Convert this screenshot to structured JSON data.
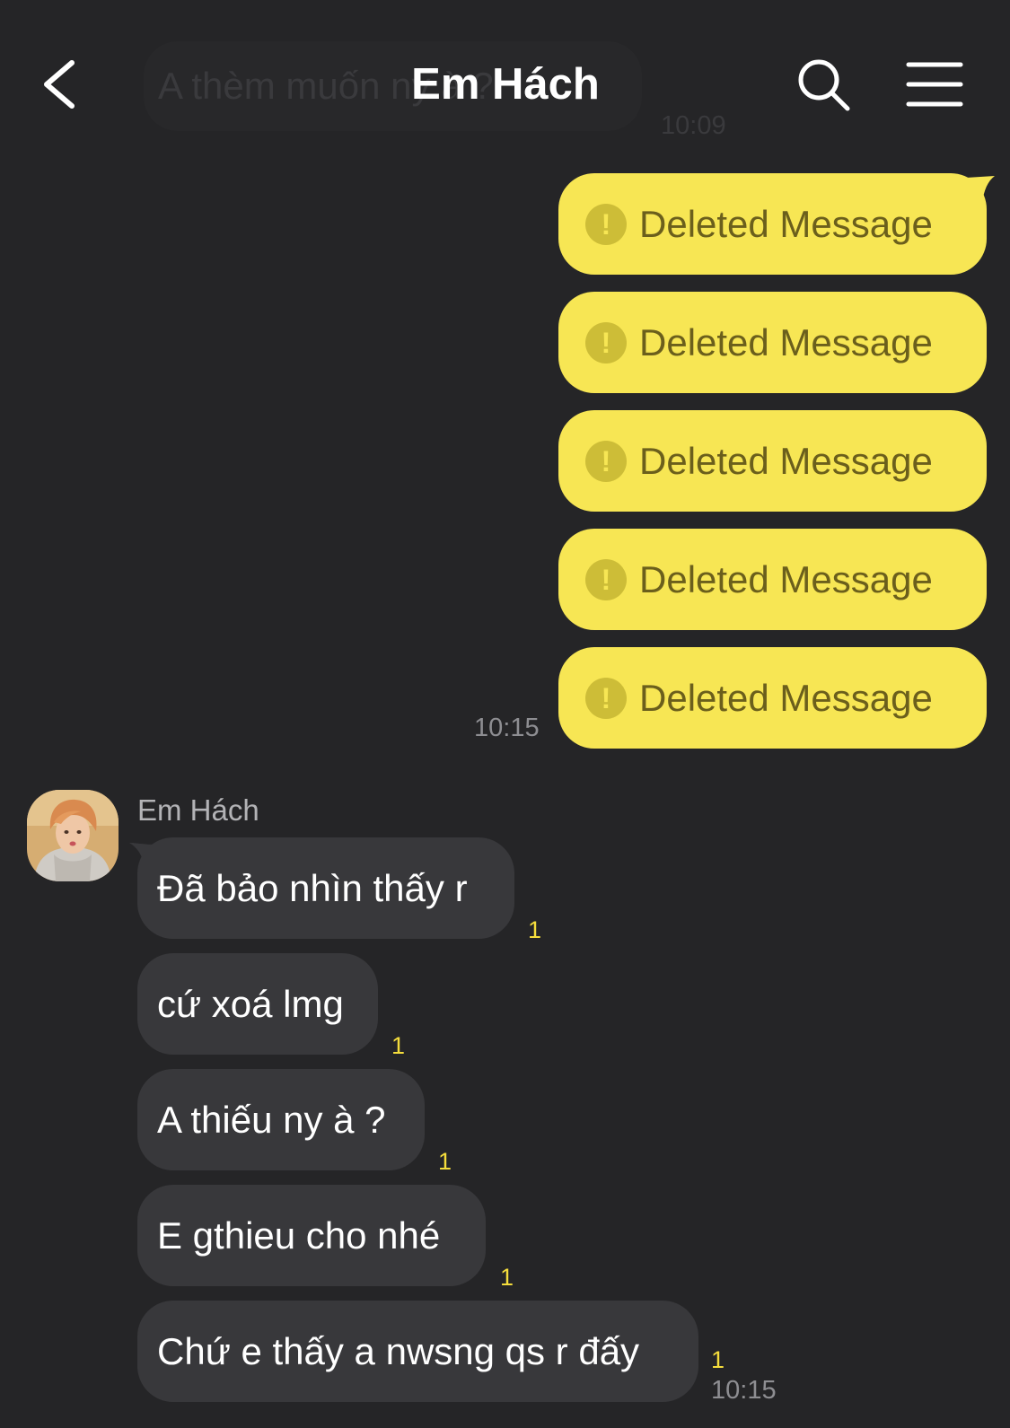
{
  "header": {
    "title": "Em Hách",
    "back_icon": "chevron-left-icon",
    "search_icon": "search-icon",
    "menu_icon": "hamburger-menu-icon"
  },
  "ghost": {
    "message": "A thèm muốn ny à ?",
    "time": "10:09"
  },
  "outgoing": {
    "deleted_label": "Deleted Message",
    "messages": [
      "Deleted Message",
      "Deleted Message",
      "Deleted Message",
      "Deleted Message",
      "Deleted Message"
    ],
    "time": "10:15"
  },
  "incoming": {
    "sender": "Em Hách",
    "messages": [
      {
        "text": "Đã bảo nhìn thấy r",
        "unread": "1"
      },
      {
        "text": "cứ xoá lmg",
        "unread": "1"
      },
      {
        "text": "A thiếu ny à ?",
        "unread": "1"
      },
      {
        "text": "E gthieu cho nhé",
        "unread": "1"
      },
      {
        "text": "Chứ e thấy a nwsng qs r đấy",
        "unread": "1"
      }
    ],
    "time": "10:15"
  },
  "colors": {
    "background": "#252527",
    "outgoing_bubble": "#f7e654",
    "incoming_bubble": "#38383b",
    "unread_count": "#f5dd3c"
  }
}
